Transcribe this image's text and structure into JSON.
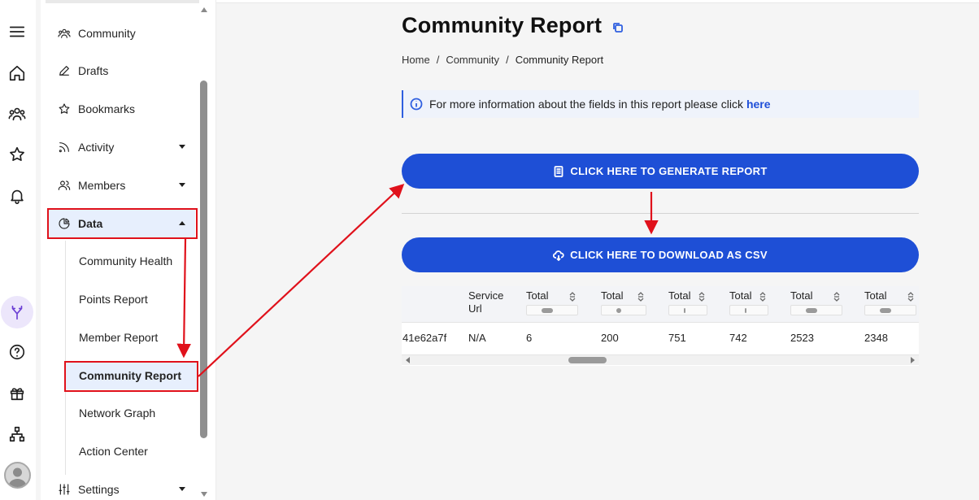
{
  "rail": {
    "items": [
      {
        "name": "menu-icon"
      },
      {
        "name": "home-icon"
      },
      {
        "name": "community-icon"
      },
      {
        "name": "star-icon"
      },
      {
        "name": "bell-icon"
      },
      {
        "name": "merge-icon"
      },
      {
        "name": "help-icon"
      },
      {
        "name": "gift-icon"
      },
      {
        "name": "sitemap-icon"
      }
    ]
  },
  "sidebar": {
    "items": [
      {
        "label": "Community",
        "icon": "community-icon"
      },
      {
        "label": "Drafts",
        "icon": "pencil-icon"
      },
      {
        "label": "Bookmarks",
        "icon": "star-icon"
      },
      {
        "label": "Activity",
        "icon": "rss-icon",
        "expandable": true
      },
      {
        "label": "Members",
        "icon": "members-icon",
        "expandable": true
      },
      {
        "label": "Data",
        "icon": "pie-chart-icon",
        "expanded": true
      }
    ],
    "data_children": [
      {
        "label": "Community Health"
      },
      {
        "label": "Points Report"
      },
      {
        "label": "Member Report"
      },
      {
        "label": "Community Report",
        "active": true
      },
      {
        "label": "Network Graph"
      },
      {
        "label": "Action Center"
      }
    ],
    "settings": {
      "label": "Settings",
      "icon": "sliders-icon"
    }
  },
  "main": {
    "title": "Community Report",
    "breadcrumb": [
      "Home",
      "Community",
      "Community Report"
    ],
    "breadcrumb_sep": "/",
    "info": {
      "text": "For more information about the fields in this report please click",
      "link": "here"
    },
    "generate_button": "CLICK HERE TO GENERATE REPORT",
    "download_button": "CLICK HERE TO DOWNLOAD AS CSV"
  },
  "table": {
    "headers": [
      "",
      "Service\nUrl",
      "Total",
      "Total",
      "Total",
      "Total",
      "Total",
      "Total"
    ],
    "header_line1": [
      "Service",
      "Total",
      "Total",
      "Total",
      "Total",
      "Total",
      "Total"
    ],
    "service_line2": "Url",
    "row": [
      "41e62a7f",
      "N/A",
      "6",
      "200",
      "751",
      "742",
      "2523",
      "2348"
    ]
  },
  "colors": {
    "accent": "#1e4fd6",
    "highlight": "#e0111b",
    "active_bg": "#e7effd"
  }
}
